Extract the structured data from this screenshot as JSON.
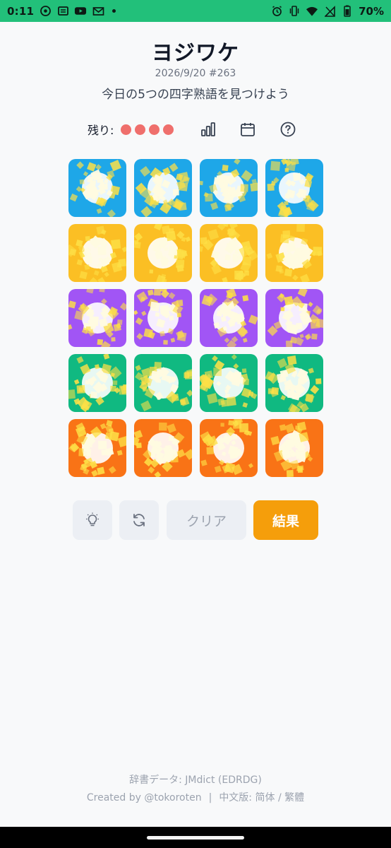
{
  "status_bar": {
    "time": "0:11",
    "battery_percent": "70%",
    "icons_left": [
      "whatsapp-icon",
      "news-icon",
      "youtube-icon",
      "mail-icon",
      "dot-icon"
    ],
    "icons_right": [
      "alarm-icon",
      "vibrate-icon",
      "wifi-icon",
      "no-sim-icon",
      "battery-icon"
    ]
  },
  "header": {
    "title": "ヨジワケ",
    "date_number": "2026/9/20 #263",
    "instruction": "今日の5つの四字熟語を見つけよう"
  },
  "lives": {
    "label": "残り:",
    "remaining": 4,
    "color": "#ef6f6c"
  },
  "header_icons": [
    "stats-icon",
    "calendar-icon",
    "help-icon"
  ],
  "grid": {
    "row_colors": [
      "#1ea7e8",
      "#fbbf24",
      "#a155f5",
      "#10b981",
      "#f97316"
    ],
    "rows": [
      [
        "",
        "",
        "",
        ""
      ],
      [
        "",
        "",
        "",
        ""
      ],
      [
        "",
        "",
        "",
        ""
      ],
      [
        "",
        "",
        "",
        ""
      ],
      [
        "",
        "",
        "",
        ""
      ]
    ],
    "sparkle_color": "#fde047"
  },
  "buttons": {
    "hint_icon": "lightbulb-icon",
    "shuffle_icon": "refresh-icon",
    "clear_label": "クリア",
    "result_label": "結果",
    "result_color": "#f59e0b"
  },
  "footer": {
    "dictionary_credit": "辞書データ: JMdict (EDRDG)",
    "created_by": "Created by @tokoroten",
    "separator": "|",
    "chinese_label": "中文版:",
    "simplified": "简体",
    "slash": "/",
    "traditional": "繁體"
  }
}
